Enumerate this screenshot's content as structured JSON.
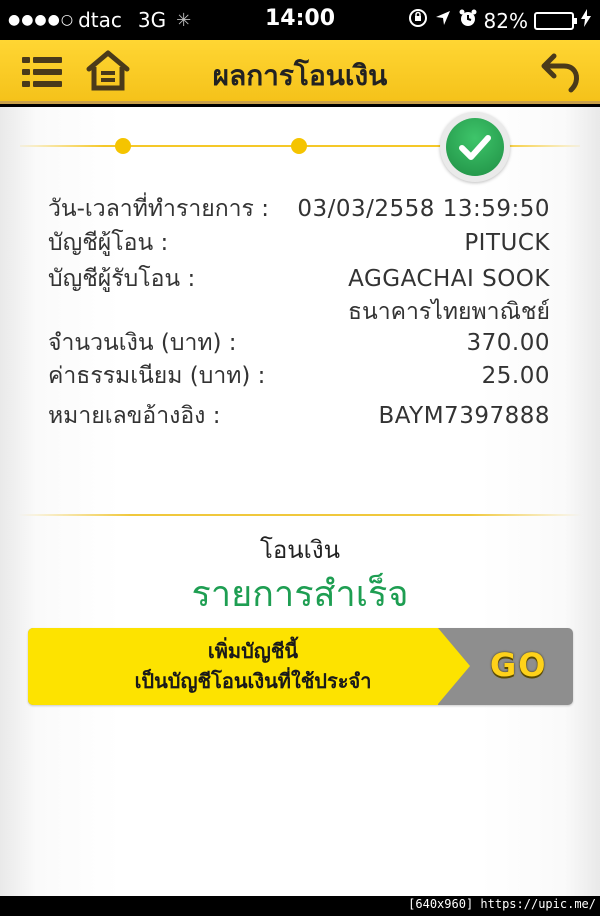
{
  "status_bar": {
    "signal": "●●●●○",
    "carrier": "dtac",
    "network": "3G",
    "time": "14:00",
    "battery_percent": 82,
    "battery_text": "82%",
    "icons": [
      "activity-spinner-icon",
      "rotation-lock-icon",
      "location-arrow-icon",
      "alarm-clock-icon",
      "charging-bolt-icon"
    ]
  },
  "nav": {
    "title": "ผลการโอนเงิน",
    "icons": [
      "menu-icon",
      "home-icon",
      "back-arrow-icon"
    ]
  },
  "progress": {
    "steps_total": 3,
    "steps_completed": 3,
    "current_step_icon": "checkmark-icon"
  },
  "details": {
    "datetime_label": "วัน-เวลาที่ทำรายการ :",
    "datetime_value": "03/03/2558 13:59:50",
    "from_label": "บัญชีผู้โอน :",
    "from_value": "PITUCK",
    "to_label": "บัญชีผู้รับโอน :",
    "to_name": "AGGACHAI SOOK",
    "to_bank": "ธนาคารไทยพาณิชย์",
    "amount_label": "จำนวนเงิน (บาท) :",
    "amount_value": "370.00",
    "fee_label": "ค่าธรรมเนียม (บาท) :",
    "fee_value": "25.00",
    "ref_label": "หมายเลขอ้างอิง :",
    "ref_value": "BAYM7397888"
  },
  "result": {
    "caption": "โอนเงิน",
    "status": "รายการสำเร็จ"
  },
  "promo": {
    "line1": "เพิ่มบัญชีนี้",
    "line2": "เป็นบัญชีโอนเงินที่ใช้ประจำ",
    "go_label": "GO"
  },
  "footer": {
    "watermark": "[640x960] https://upic.me/"
  },
  "colors": {
    "nav_yellow": "#f5c21a",
    "success_green": "#1e9e52",
    "step_yellow": "#f5c400",
    "promo_yellow": "#fde300",
    "promo_gray": "#8e8e8e",
    "battery_green": "#4cd964"
  }
}
